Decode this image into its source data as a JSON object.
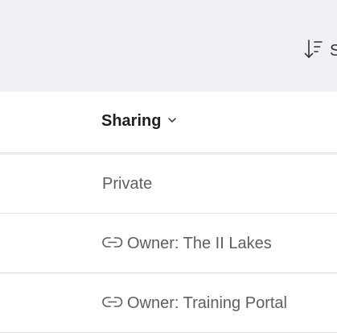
{
  "toolbar": {
    "sort_label": "S",
    "sort_icon": "sort-descending-icon"
  },
  "table": {
    "columns": [
      {
        "label": "Sharing",
        "icon": "chevron-down-icon"
      }
    ],
    "rows": [
      {
        "sharing": "Private",
        "icon": null
      },
      {
        "sharing": "Owner: The II Lakes",
        "icon": "link-icon"
      },
      {
        "sharing": "Owner: Training Portal",
        "icon": "link-icon"
      }
    ]
  },
  "colors": {
    "toolbar_bg": "#f0f1f4",
    "text_primary": "#201f1e",
    "text_secondary": "#605e5c",
    "divider": "#e1dfdd"
  }
}
